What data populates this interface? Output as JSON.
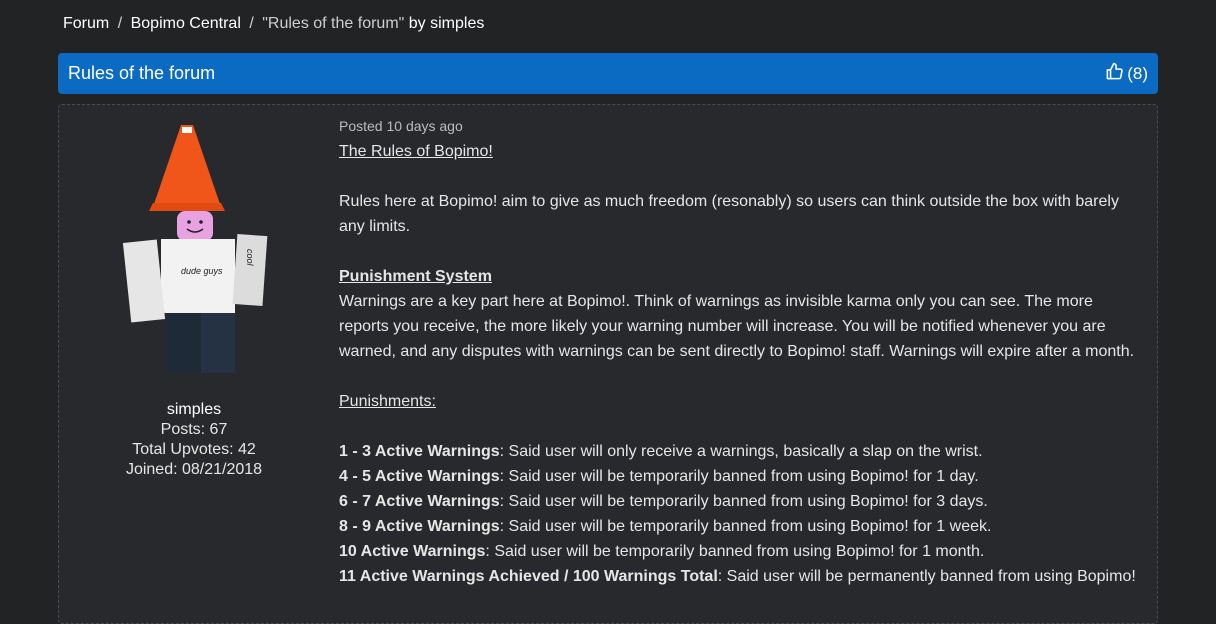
{
  "breadcrumb": {
    "forum": "Forum",
    "sep1": "/",
    "section": "Bopimo Central",
    "sep2": "/",
    "thread": "\"Rules of the forum\"",
    "by": "by simples"
  },
  "thread": {
    "title": "Rules of the forum",
    "upvotes": "(8)"
  },
  "author": {
    "username": "simples",
    "posts": "Posts: 67",
    "upvotes": "Total Upvotes: 42",
    "joined": "Joined: 08/21/2018",
    "shirt_front": "dude guys",
    "shirt_side": "cool"
  },
  "post": {
    "posted": "Posted 10 days ago",
    "heading": "The Rules of Bopimo!",
    "intro": "Rules here at Bopimo! aim to give as much freedom (resonably) so users can think outside the box with barely any limits.",
    "punishment_system_heading": "Punishment System",
    "punishment_system_body": "Warnings are a key part here at Bopimo!. Think of warnings as invisible karma only you can see. The more reports you receive, the more likely your warning number will increase. You will be notified whenever you are warned, and any disputes with warnings can be sent directly to Bopimo! staff. Warnings will expire after a month.",
    "punishments_heading": "Punishments:",
    "punishments": [
      {
        "label": "1 - 3 Active Warnings",
        "text": ": Said user will only receive a warnings, basically a slap on the wrist."
      },
      {
        "label": "4 - 5 Active Warnings",
        "text": ": Said user will be temporarily banned from using Bopimo! for 1 day."
      },
      {
        "label": "6 - 7 Active Warnings",
        "text": ": Said user will be temporarily banned from using Bopimo! for 3 days."
      },
      {
        "label": "8 - 9 Active Warnings",
        "text": ": Said user will be temporarily banned from using Bopimo! for 1 week."
      },
      {
        "label": "10 Active Warnings",
        "text": ": Said user will be temporarily banned from using Bopimo! for 1 month."
      },
      {
        "label": "11 Active Warnings Achieved / 100 Warnings Total",
        "text": ": Said user will be permanently banned from using Bopimo!"
      }
    ]
  },
  "colors": {
    "background": "#222325",
    "title_bar": "#0b6bc2",
    "card": "#27292c",
    "cone": "#f0561a"
  }
}
